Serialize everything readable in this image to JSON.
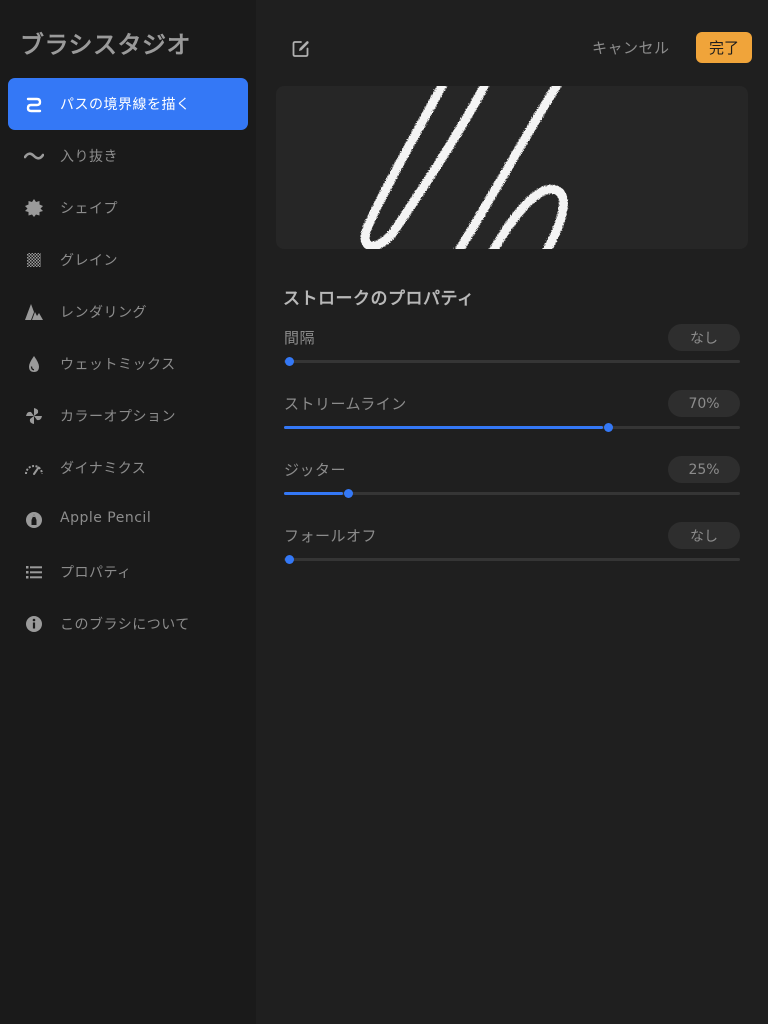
{
  "sidebar": {
    "title": "ブラシスタジオ",
    "items": [
      {
        "label": "パスの境界線を描く",
        "icon": "stroke-path-icon",
        "active": true
      },
      {
        "label": "入り抜き",
        "icon": "taper-icon",
        "active": false
      },
      {
        "label": "シェイプ",
        "icon": "shape-icon",
        "active": false
      },
      {
        "label": "グレイン",
        "icon": "grain-icon",
        "active": false
      },
      {
        "label": "レンダリング",
        "icon": "rendering-icon",
        "active": false
      },
      {
        "label": "ウェットミックス",
        "icon": "wet-mix-icon",
        "active": false
      },
      {
        "label": "カラーオプション",
        "icon": "color-options-icon",
        "active": false
      },
      {
        "label": "ダイナミクス",
        "icon": "dynamics-icon",
        "active": false
      },
      {
        "label": "Apple Pencil",
        "icon": "apple-pencil-icon",
        "active": false
      },
      {
        "label": "プロパティ",
        "icon": "properties-icon",
        "active": false
      },
      {
        "label": "このブラシについて",
        "icon": "info-icon",
        "active": false
      }
    ]
  },
  "toolbar": {
    "edit_icon": "edit-icon",
    "cancel_label": "キャンセル",
    "done_label": "完了"
  },
  "main": {
    "section_title": "ストロークのプロパティ",
    "properties": [
      {
        "label": "間隔",
        "value": "なし",
        "level": 0
      },
      {
        "label": "ストリームライン",
        "value": "70%",
        "level": 0.7
      },
      {
        "label": "ジッター",
        "value": "25%",
        "level": 0.13
      },
      {
        "label": "フォールオフ",
        "value": "なし",
        "level": 0
      }
    ]
  },
  "colors": {
    "accent": "#3478f6",
    "done_button": "#f0a43a",
    "sidebar_bg": "#1a1a1a",
    "main_bg": "#1f1f1f"
  }
}
